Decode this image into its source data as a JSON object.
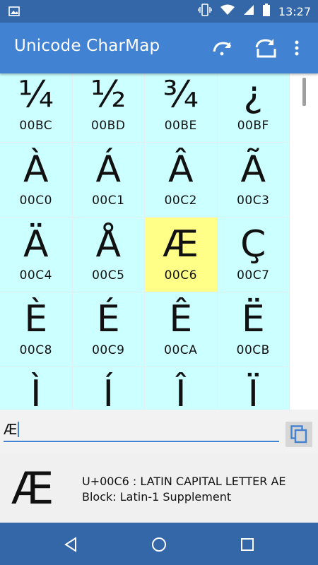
{
  "status_bar": {
    "time": "13:27",
    "icons": [
      "image-icon",
      "vibrate-icon",
      "wifi-icon",
      "signal-icon",
      "battery-icon"
    ]
  },
  "app_bar": {
    "title": "Unicode CharMap",
    "actions": [
      "jump-forward-icon",
      "jump-to-icon",
      "more-vert-icon"
    ]
  },
  "grid": {
    "cells": [
      {
        "glyph": "¼",
        "code": "00BC"
      },
      {
        "glyph": "½",
        "code": "00BD"
      },
      {
        "glyph": "¾",
        "code": "00BE"
      },
      {
        "glyph": "¿",
        "code": "00BF"
      },
      {
        "glyph": "À",
        "code": "00C0"
      },
      {
        "glyph": "Á",
        "code": "00C1"
      },
      {
        "glyph": "Â",
        "code": "00C2"
      },
      {
        "glyph": "Ã",
        "code": "00C3"
      },
      {
        "glyph": "Ä",
        "code": "00C4"
      },
      {
        "glyph": "Å",
        "code": "00C5"
      },
      {
        "glyph": "Æ",
        "code": "00C6",
        "selected": true
      },
      {
        "glyph": "Ç",
        "code": "00C7"
      },
      {
        "glyph": "È",
        "code": "00C8"
      },
      {
        "glyph": "É",
        "code": "00C9"
      },
      {
        "glyph": "Ê",
        "code": "00CA"
      },
      {
        "glyph": "Ë",
        "code": "00CB"
      },
      {
        "glyph": "Ì",
        "code": ""
      },
      {
        "glyph": "Í",
        "code": ""
      },
      {
        "glyph": "Î",
        "code": ""
      },
      {
        "glyph": "Ï",
        "code": ""
      }
    ]
  },
  "input": {
    "value": "Æ"
  },
  "info": {
    "glyph": "Æ",
    "name_line": "U+00C6 : LATIN CAPITAL LETTER AE",
    "block_line": "Block: Latin-1 Supplement"
  },
  "colors": {
    "status_bar": "#3367a8",
    "app_bar": "#4282d3",
    "grid_bg": "#ccffff",
    "selected_bg": "#ffff88"
  }
}
